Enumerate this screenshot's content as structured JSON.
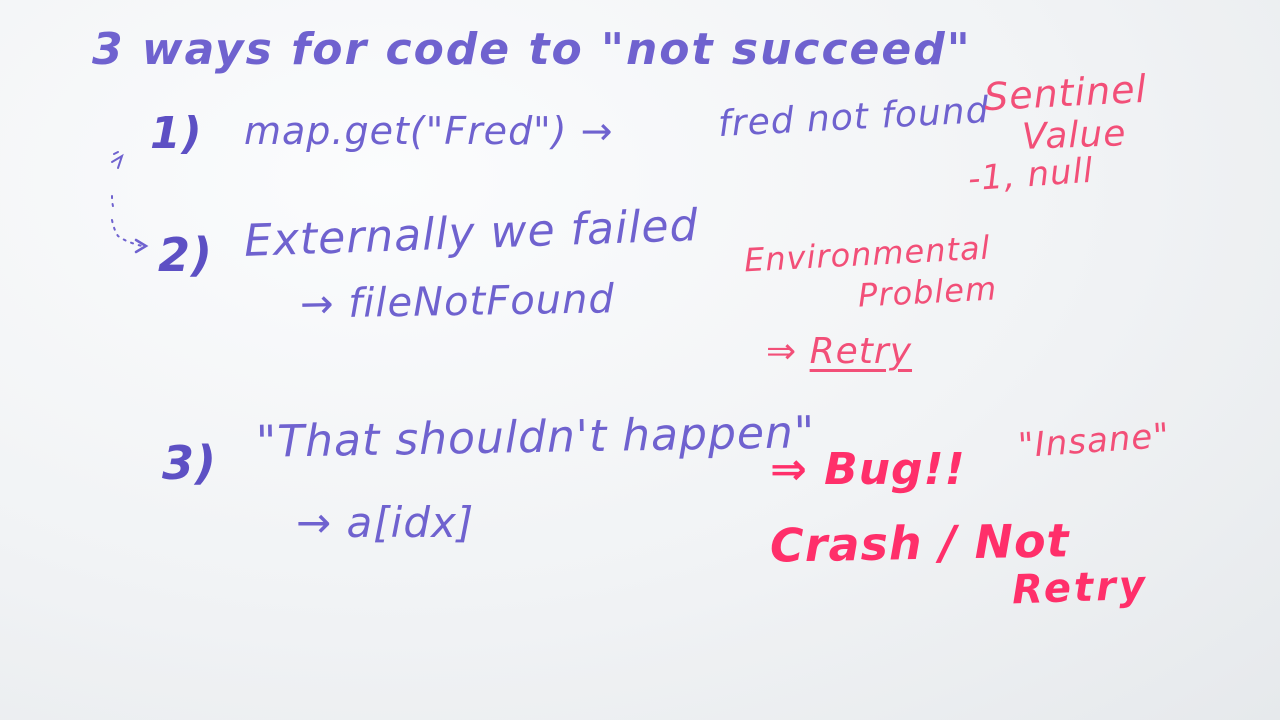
{
  "title": "3 ways for code to \"not succeed\"",
  "item1": {
    "number": "1)",
    "code": "map.get(\"Fred\") →",
    "note": "fred not found",
    "side_label_1": "Sentinel",
    "side_label_2": "Value",
    "side_label_3": "-1, null"
  },
  "item2": {
    "number": "2)",
    "text": "Externally we failed",
    "sub": "→ fileNotFound",
    "side_label_1": "Environmental",
    "side_label_2": "Problem",
    "side_arrow": "⇒",
    "side_label_3": "Retry"
  },
  "item3": {
    "number": "3)",
    "text": "\"That shouldn't happen\"",
    "sub": "→  a[idx]",
    "side_line_1": "⇒ Bug!!",
    "side_label_insane": "\"Insane\"",
    "side_line_2": "Crash / Not",
    "side_line_3": "Retry"
  },
  "colors": {
    "purple_marker": "#6f62cf",
    "pink_marker": "#f24f78",
    "hot_pink_marker": "#ff2f6a",
    "whiteboard": "#f1f3f5"
  }
}
